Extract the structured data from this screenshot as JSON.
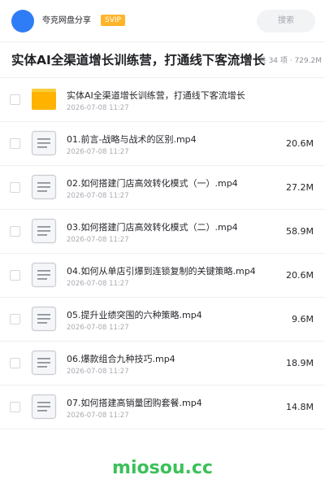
{
  "header": {
    "user_name": "夸克网盘分享",
    "badge": "SVIP",
    "search_placeholder": "搜索",
    "avatar_color": "#2f7df6",
    "badge_color": "#ffb52a"
  },
  "folder": {
    "title": "实体AI全渠道增长训练营，打通线下客流增长",
    "meta": "共 34 项 · 729.2M"
  },
  "files": [
    {
      "name": "实体AI全渠道增长训练营，打通线下客流增长",
      "date": "2026-07-08 11:27",
      "size": "",
      "icon": "folder-icon"
    },
    {
      "name": "01.前言-战略与战术的区别.mp4",
      "date": "2026-07-08 11:27",
      "size": "20.6M",
      "icon": "file-icon"
    },
    {
      "name": "02.如何搭建门店高效转化模式（一）.mp4",
      "date": "2026-07-08 11:27",
      "size": "27.2M",
      "icon": "file-icon"
    },
    {
      "name": "03.如何搭建门店高效转化模式（二）.mp4",
      "date": "2026-07-08 11:27",
      "size": "58.9M",
      "icon": "file-icon"
    },
    {
      "name": "04.如何从单店引爆到连锁复制的关键策略.mp4",
      "date": "2026-07-08 11:27",
      "size": "20.6M",
      "icon": "file-icon"
    },
    {
      "name": "05.提升业绩突围的六种策略.mp4",
      "date": "2026-07-08 11:27",
      "size": "9.6M",
      "icon": "file-icon"
    },
    {
      "name": "06.爆款组合九种技巧.mp4",
      "date": "2026-07-08 11:27",
      "size": "18.9M",
      "icon": "file-icon"
    },
    {
      "name": "07.如何搭建高销量团购套餐.mp4",
      "date": "2026-07-08 11:27",
      "size": "14.8M",
      "icon": "file-icon"
    }
  ],
  "watermark": "miosou.cc"
}
